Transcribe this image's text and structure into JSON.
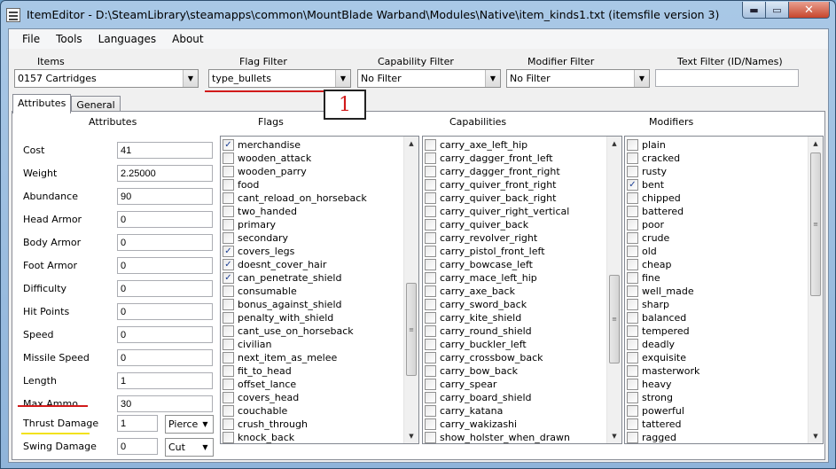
{
  "window": {
    "title": "ItemEditor - D:\\SteamLibrary\\steamapps\\common\\MountBlade Warband\\Modules\\Native\\item_kinds1.txt (itemsfile version 3)",
    "caption_min": "▬",
    "caption_max": "▭",
    "caption_close": "✕"
  },
  "menu": [
    "File",
    "Tools",
    "Languages",
    "About"
  ],
  "filters": {
    "items_label": "Items",
    "items_value": "0157 Cartridges",
    "flag_label": "Flag Filter",
    "flag_value": "type_bullets",
    "capability_label": "Capability Filter",
    "capability_value": "No Filter",
    "modifier_label": "Modifier Filter",
    "modifier_value": "No Filter",
    "text_label": "Text Filter (ID/Names)",
    "text_value": ""
  },
  "tabs": [
    "Attributes",
    "General"
  ],
  "headers": {
    "attributes": "Attributes",
    "flags": "Flags",
    "capabilities": "Capabilities",
    "modifiers": "Modifiers"
  },
  "attributes": [
    {
      "label": "Cost",
      "value": "41"
    },
    {
      "label": "Weight",
      "value": "2.25000"
    },
    {
      "label": "Abundance",
      "value": "90"
    },
    {
      "label": "Head Armor",
      "value": "0"
    },
    {
      "label": "Body Armor",
      "value": "0"
    },
    {
      "label": "Foot Armor",
      "value": "0"
    },
    {
      "label": "Difficulty",
      "value": "0"
    },
    {
      "label": "Hit Points",
      "value": "0"
    },
    {
      "label": "Speed",
      "value": "0"
    },
    {
      "label": "Missile Speed",
      "value": "0"
    },
    {
      "label": "Length",
      "value": "1"
    },
    {
      "label": "Max Ammo",
      "value": "30"
    }
  ],
  "damage": [
    {
      "label": "Thrust Damage",
      "value": "1",
      "type": "Pierce"
    },
    {
      "label": "Swing Damage",
      "value": "0",
      "type": "Cut"
    }
  ],
  "flags": [
    {
      "name": "merchandise",
      "checked": true
    },
    {
      "name": "wooden_attack",
      "checked": false
    },
    {
      "name": "wooden_parry",
      "checked": false
    },
    {
      "name": "food",
      "checked": false
    },
    {
      "name": "cant_reload_on_horseback",
      "checked": false
    },
    {
      "name": "two_handed",
      "checked": false
    },
    {
      "name": "primary",
      "checked": false
    },
    {
      "name": "secondary",
      "checked": false
    },
    {
      "name": "covers_legs",
      "checked": true
    },
    {
      "name": "doesnt_cover_hair",
      "checked": true
    },
    {
      "name": "can_penetrate_shield",
      "checked": true
    },
    {
      "name": "consumable",
      "checked": false
    },
    {
      "name": "bonus_against_shield",
      "checked": false
    },
    {
      "name": "penalty_with_shield",
      "checked": false
    },
    {
      "name": "cant_use_on_horseback",
      "checked": false
    },
    {
      "name": "civilian",
      "checked": false
    },
    {
      "name": "next_item_as_melee",
      "checked": false
    },
    {
      "name": "fit_to_head",
      "checked": false
    },
    {
      "name": "offset_lance",
      "checked": false
    },
    {
      "name": "covers_head",
      "checked": false
    },
    {
      "name": "couchable",
      "checked": false
    },
    {
      "name": "crush_through",
      "checked": false
    },
    {
      "name": "knock_back",
      "checked": false
    }
  ],
  "capabilities": [
    {
      "name": "carry_axe_left_hip",
      "checked": false
    },
    {
      "name": "carry_dagger_front_left",
      "checked": false
    },
    {
      "name": "carry_dagger_front_right",
      "checked": false
    },
    {
      "name": "carry_quiver_front_right",
      "checked": false
    },
    {
      "name": "carry_quiver_back_right",
      "checked": false
    },
    {
      "name": "carry_quiver_right_vertical",
      "checked": false
    },
    {
      "name": "carry_quiver_back",
      "checked": false
    },
    {
      "name": "carry_revolver_right",
      "checked": false
    },
    {
      "name": "carry_pistol_front_left",
      "checked": false
    },
    {
      "name": "carry_bowcase_left",
      "checked": false
    },
    {
      "name": "carry_mace_left_hip",
      "checked": false
    },
    {
      "name": "carry_axe_back",
      "checked": false
    },
    {
      "name": "carry_sword_back",
      "checked": false
    },
    {
      "name": "carry_kite_shield",
      "checked": false
    },
    {
      "name": "carry_round_shield",
      "checked": false
    },
    {
      "name": "carry_buckler_left",
      "checked": false
    },
    {
      "name": "carry_crossbow_back",
      "checked": false
    },
    {
      "name": "carry_bow_back",
      "checked": false
    },
    {
      "name": "carry_spear",
      "checked": false
    },
    {
      "name": "carry_board_shield",
      "checked": false
    },
    {
      "name": "carry_katana",
      "checked": false
    },
    {
      "name": "carry_wakizashi",
      "checked": false
    },
    {
      "name": "show_holster_when_drawn",
      "checked": false
    }
  ],
  "modifiers": [
    {
      "name": "plain",
      "checked": false
    },
    {
      "name": "cracked",
      "checked": false
    },
    {
      "name": "rusty",
      "checked": false
    },
    {
      "name": "bent",
      "checked": true
    },
    {
      "name": "chipped",
      "checked": false
    },
    {
      "name": "battered",
      "checked": false
    },
    {
      "name": "poor",
      "checked": false
    },
    {
      "name": "crude",
      "checked": false
    },
    {
      "name": "old",
      "checked": false
    },
    {
      "name": "cheap",
      "checked": false
    },
    {
      "name": "fine",
      "checked": false
    },
    {
      "name": "well_made",
      "checked": false
    },
    {
      "name": "sharp",
      "checked": false
    },
    {
      "name": "balanced",
      "checked": false
    },
    {
      "name": "tempered",
      "checked": false
    },
    {
      "name": "deadly",
      "checked": false
    },
    {
      "name": "exquisite",
      "checked": false
    },
    {
      "name": "masterwork",
      "checked": false
    },
    {
      "name": "heavy",
      "checked": false
    },
    {
      "name": "strong",
      "checked": false
    },
    {
      "name": "powerful",
      "checked": false
    },
    {
      "name": "tattered",
      "checked": false
    },
    {
      "name": "ragged",
      "checked": false
    }
  ],
  "annotation": {
    "callout_number": "1"
  },
  "icons": {
    "combo_arrow": "▼",
    "scroll_up": "▲",
    "scroll_down": "▼",
    "thumb_grip": "≡",
    "check": "✓"
  }
}
